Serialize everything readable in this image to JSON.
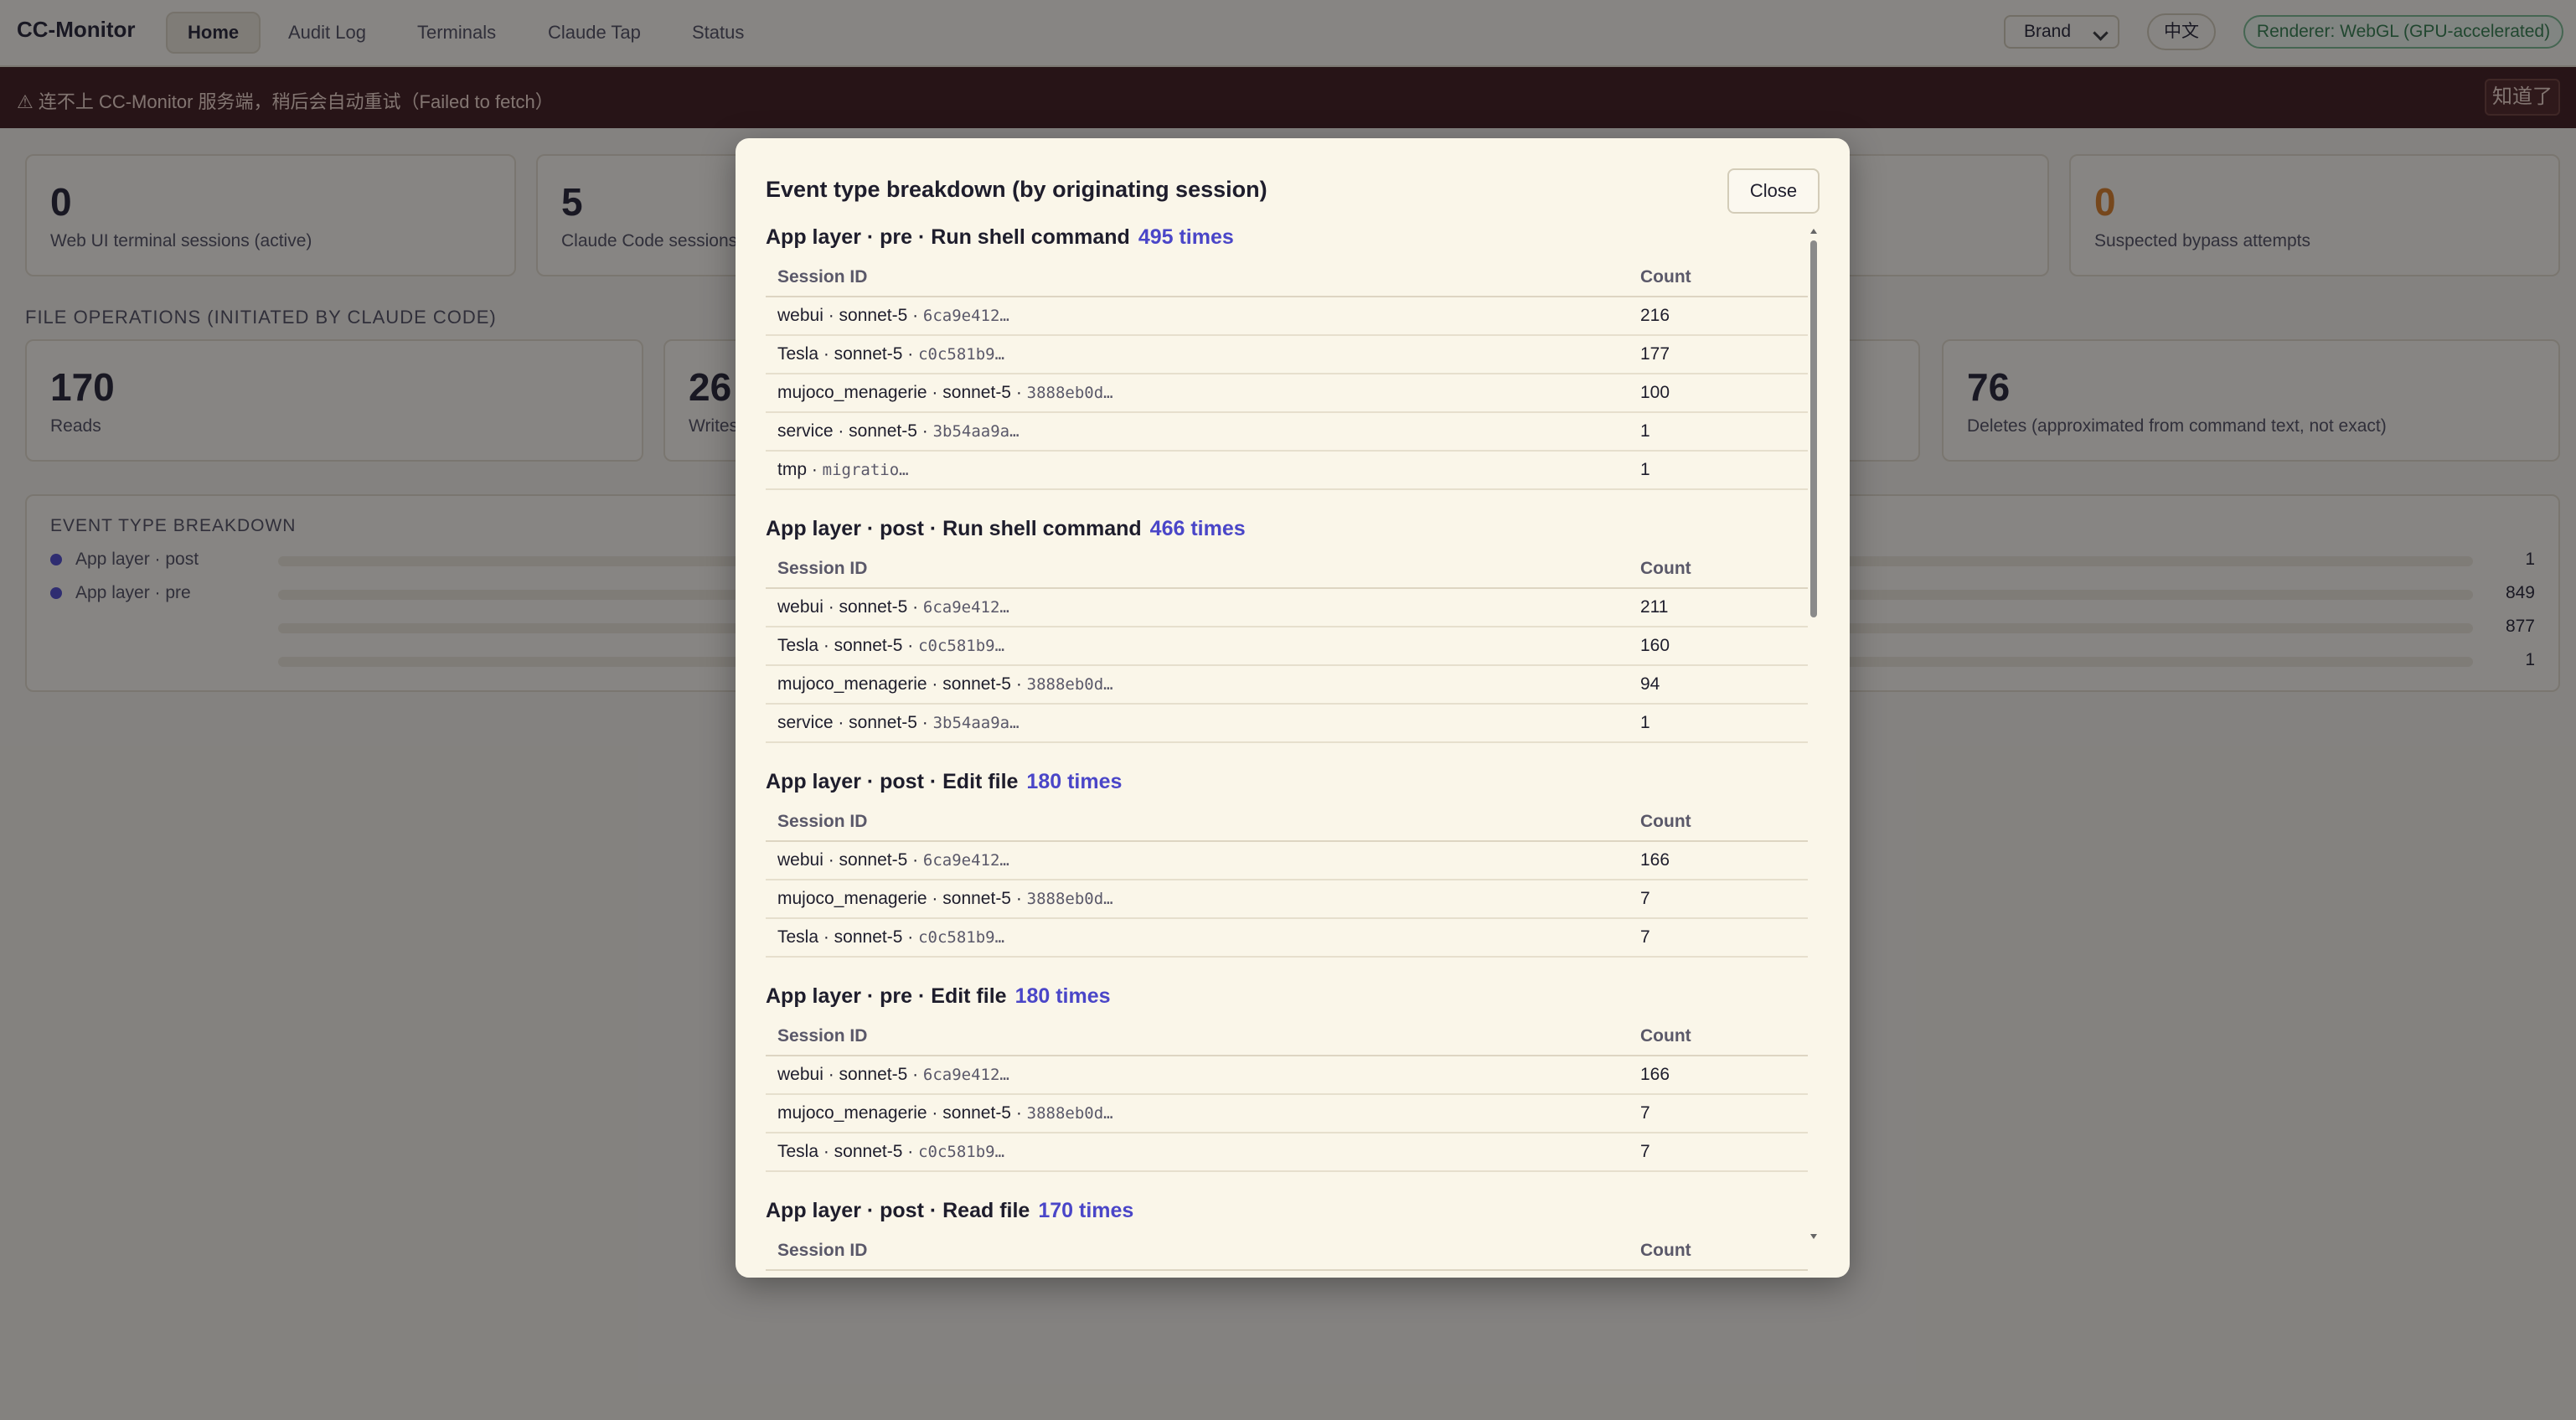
{
  "app": {
    "name": "CC-Monitor"
  },
  "nav": {
    "tabs": [
      "Home",
      "Audit Log",
      "Terminals",
      "Claude Tap",
      "Status"
    ],
    "theme_select": "Brand",
    "lang_button": "中文",
    "renderer_badge": "Renderer: WebGL (GPU-accelerated)"
  },
  "alert": {
    "message": "⚠ 连不上 CC-Monitor 服务端，稍后会自动重试（Failed to fetch）",
    "dismiss": "知道了"
  },
  "summary_cards": {
    "web_ui_sessions": {
      "value": "0",
      "label": "Web UI terminal sessions (active)"
    },
    "claude_sessions": {
      "value": "5",
      "label": "Claude Code sessions"
    },
    "bypass": {
      "value": "0",
      "label": "Suspected bypass attempts"
    }
  },
  "file_ops": {
    "section_title": "FILE OPERATIONS (INITIATED BY CLAUDE CODE)",
    "reads": {
      "value": "170",
      "label": "Reads"
    },
    "writes": {
      "value": "26",
      "label": "Writes"
    },
    "deletes": {
      "value": "76",
      "label": "Deletes (approximated from command text, not exact)"
    }
  },
  "event_breakdown": {
    "title": "EVENT TYPE BREAKDOWN",
    "rows": [
      {
        "label": "App layer · post"
      },
      {
        "label": "App layer · pre"
      }
    ],
    "right_values": [
      "1",
      "849",
      "877",
      "1"
    ]
  },
  "modal": {
    "title": "Event type breakdown (by originating session)",
    "close": "Close",
    "col_session": "Session ID",
    "col_count": "Count",
    "groups": [
      {
        "title": "App layer · pre · Run shell command",
        "times": "495 times",
        "rows": [
          {
            "name": "webui · sonnet-5 · ",
            "hash": "6ca9e412…",
            "count": "216"
          },
          {
            "name": "Tesla · sonnet-5 · ",
            "hash": "c0c581b9…",
            "count": "177"
          },
          {
            "name": "mujoco_menagerie · sonnet-5 · ",
            "hash": "3888eb0d…",
            "count": "100"
          },
          {
            "name": "service · sonnet-5 · ",
            "hash": "3b54aa9a…",
            "count": "1"
          },
          {
            "name": "tmp · ",
            "hash": "migratio…",
            "count": "1"
          }
        ]
      },
      {
        "title": "App layer · post · Run shell command",
        "times": "466 times",
        "rows": [
          {
            "name": "webui · sonnet-5 · ",
            "hash": "6ca9e412…",
            "count": "211"
          },
          {
            "name": "Tesla · sonnet-5 · ",
            "hash": "c0c581b9…",
            "count": "160"
          },
          {
            "name": "mujoco_menagerie · sonnet-5 · ",
            "hash": "3888eb0d…",
            "count": "94"
          },
          {
            "name": "service · sonnet-5 · ",
            "hash": "3b54aa9a…",
            "count": "1"
          }
        ]
      },
      {
        "title": "App layer · post · Edit file",
        "times": "180 times",
        "rows": [
          {
            "name": "webui · sonnet-5 · ",
            "hash": "6ca9e412…",
            "count": "166"
          },
          {
            "name": "mujoco_menagerie · sonnet-5 · ",
            "hash": "3888eb0d…",
            "count": "7"
          },
          {
            "name": "Tesla · sonnet-5 · ",
            "hash": "c0c581b9…",
            "count": "7"
          }
        ]
      },
      {
        "title": "App layer · pre · Edit file",
        "times": "180 times",
        "rows": [
          {
            "name": "webui · sonnet-5 · ",
            "hash": "6ca9e412…",
            "count": "166"
          },
          {
            "name": "mujoco_menagerie · sonnet-5 · ",
            "hash": "3888eb0d…",
            "count": "7"
          },
          {
            "name": "Tesla · sonnet-5 · ",
            "hash": "c0c581b9…",
            "count": "7"
          }
        ]
      },
      {
        "title": "App layer · post · Read file",
        "times": "170 times",
        "rows": []
      }
    ]
  },
  "colors": {
    "accent": "#4a46c8",
    "warning": "#d97a1f",
    "alert_bg": "#3a1515",
    "renderer_green": "#2f7a46"
  }
}
